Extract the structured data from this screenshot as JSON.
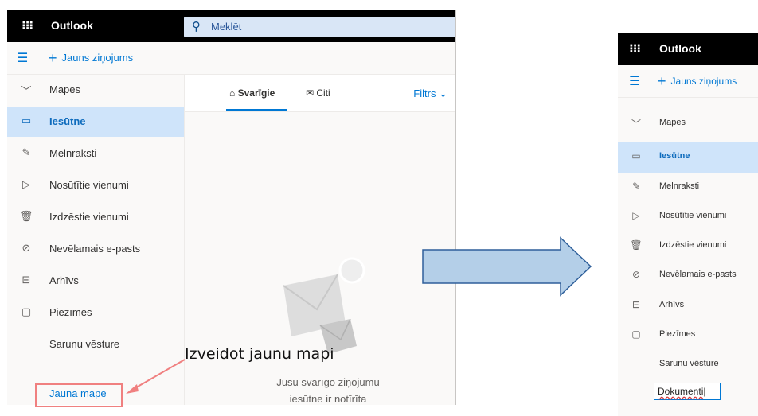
{
  "left": {
    "app_name": "Outlook",
    "search_placeholder": "Meklēt",
    "new_message": "Jauns ziņojums",
    "folders_label": "Mapes",
    "folders": [
      {
        "label": "Iesūtne",
        "icon": "inbox-icon",
        "selected": true
      },
      {
        "label": "Melnraksti",
        "icon": "pencil-icon"
      },
      {
        "label": "Nosūtītie vienumi",
        "icon": "send-icon"
      },
      {
        "label": "Izdzēstie vienumi",
        "icon": "trash-icon"
      },
      {
        "label": "Nevēlamais e-pasts",
        "icon": "block-icon"
      },
      {
        "label": "Arhīvs",
        "icon": "archive-icon"
      },
      {
        "label": "Piezīmes",
        "icon": "note-icon"
      },
      {
        "label": "Sarunu vēsture",
        "icon": ""
      }
    ],
    "new_folder": "Jauna mape",
    "tabs": {
      "focused": "Svarīgie",
      "other": "Citi"
    },
    "filter": "Filtrs",
    "empty_title": "Izveidot jaunu mapi",
    "empty_line1": "Jūsu svarīgo ziņojumu",
    "empty_line2": "iesūtne ir notīrīta"
  },
  "right": {
    "app_name": "Outlook",
    "new_message": "Jauns ziņojums",
    "folders_label": "Mapes",
    "folders": [
      {
        "label": "Iesūtne",
        "selected": true
      },
      {
        "label": "Melnraksti"
      },
      {
        "label": "Nosūtītie vienumi"
      },
      {
        "label": "Izdzēstie vienumi"
      },
      {
        "label": "Nevēlamais e-pasts"
      },
      {
        "label": "Arhīvs"
      },
      {
        "label": "Piezīmes"
      },
      {
        "label": "Sarunu vēsture"
      }
    ],
    "new_folder_value": "Dokumenti"
  },
  "colors": {
    "accent": "#0078d4",
    "callout": "#f08080",
    "arrow_fill": "#b4cfe8",
    "arrow_stroke": "#2e5f9a"
  }
}
